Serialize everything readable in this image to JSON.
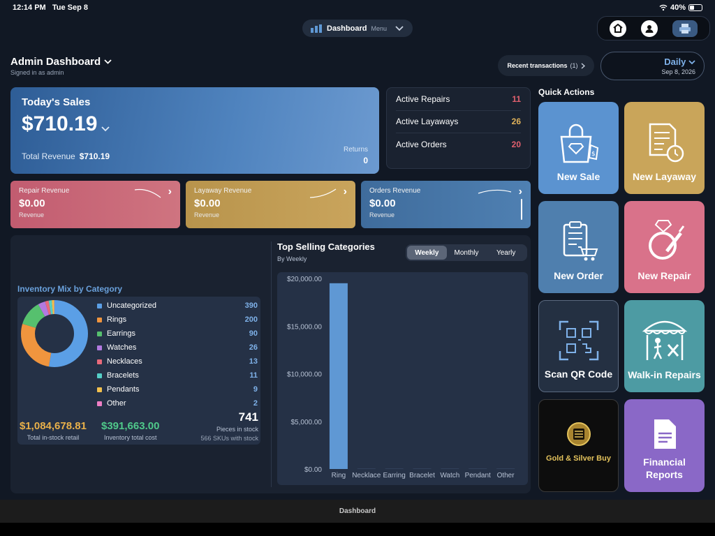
{
  "status_bar": {
    "time": "12:14 PM",
    "date": "Tue Sep 8",
    "battery": "40%"
  },
  "top_pill": {
    "title": "Dashboard",
    "menu": "Menu"
  },
  "header": {
    "title": "Admin Dashboard",
    "subtitle": "Signed in as admin",
    "recent_label": "Recent transactions",
    "recent_count": "(1)",
    "period": "Daily",
    "date": "Sep 8, 2026"
  },
  "sales": {
    "title": "Today's Sales",
    "amount": "$710.19",
    "total_label": "Total Revenue",
    "total_value": "$710.19",
    "returns_label": "Returns",
    "returns_value": "0"
  },
  "active": [
    {
      "label": "Active Repairs",
      "value": "11",
      "color": "#e2606e"
    },
    {
      "label": "Active Layaways",
      "value": "26",
      "color": "#e0b25a"
    },
    {
      "label": "Active Orders",
      "value": "20",
      "color": "#e2606e"
    }
  ],
  "revenue_cards": [
    {
      "title": "Repair Revenue",
      "value": "$0.00",
      "label": "Revenue",
      "color": "#c9687a"
    },
    {
      "title": "Layaway Revenue",
      "value": "$0.00",
      "label": "Revenue",
      "color": "#bd9b52"
    },
    {
      "title": "Orders Revenue",
      "value": "$0.00",
      "label": "Revenue",
      "color": "#4a76a6"
    }
  ],
  "inventory": {
    "title": "Inventory Mix by Category",
    "categories": [
      {
        "name": "Uncategorized",
        "value": 390,
        "color": "#5b9fe6"
      },
      {
        "name": "Rings",
        "value": 200,
        "color": "#f0953e"
      },
      {
        "name": "Earrings",
        "value": 90,
        "color": "#56c06e"
      },
      {
        "name": "Watches",
        "value": 26,
        "color": "#b27ae0"
      },
      {
        "name": "Necklaces",
        "value": 13,
        "color": "#e86a7a"
      },
      {
        "name": "Bracelets",
        "value": 11,
        "color": "#55cfc7"
      },
      {
        "name": "Pendants",
        "value": 9,
        "color": "#f2c04e"
      },
      {
        "name": "Other",
        "value": 2,
        "color": "#ee7fc5"
      }
    ],
    "retail_value": "$1,084,678.81",
    "retail_label": "Total in-stock retail",
    "retail_color": "#e8b04a",
    "cost_value": "$391,663.00",
    "cost_label": "Inventory total cost",
    "cost_color": "#4fc98a",
    "pieces_value": "741",
    "pieces_label": "Pieces in stock",
    "skus_label": "566 SKUs with stock"
  },
  "top_selling": {
    "title": "Top Selling Categories",
    "subtitle": "By Weekly",
    "tabs": [
      "Weekly",
      "Monthly",
      "Yearly"
    ],
    "active_tab": "Weekly"
  },
  "chart_data": {
    "type": "bar",
    "categories": [
      "Ring",
      "Necklace",
      "Earring",
      "Bracelet",
      "Watch",
      "Pendant",
      "Other"
    ],
    "values": [
      19500,
      0,
      0,
      0,
      0,
      0,
      0
    ],
    "y_ticks": [
      "$0.00",
      "$5,000.00",
      "$10,000.00",
      "$15,000.00",
      "$20,000.00"
    ],
    "ylim": [
      0,
      20000
    ],
    "bar_color": "#5f98d4"
  },
  "quick_actions": {
    "title": "Quick Actions",
    "items": [
      {
        "label": "New Sale",
        "color": "#5b93d0",
        "icon": "shopping-bag-icon"
      },
      {
        "label": "New Layaway",
        "color": "#c9a55a",
        "icon": "layaway-document-icon"
      },
      {
        "label": "New Order",
        "color": "#4f7fae",
        "icon": "clipboard-cart-icon"
      },
      {
        "label": "New Repair",
        "color": "#d9728a",
        "icon": "ring-screwdriver-icon"
      },
      {
        "label": "Scan QR Code",
        "color": "#243042",
        "icon": "qr-code-icon"
      },
      {
        "label": "Walk-in Repairs",
        "color": "#4d9ba3",
        "icon": "storefront-icon"
      },
      {
        "label": "Gold & Silver Buy",
        "color": "#0d0d0d",
        "icon": "gold-coin-icon"
      },
      {
        "label": "Financial Reports",
        "color": "#8a68c7",
        "icon": "report-document-icon"
      }
    ]
  },
  "tab_bar": {
    "label": "Dashboard"
  }
}
